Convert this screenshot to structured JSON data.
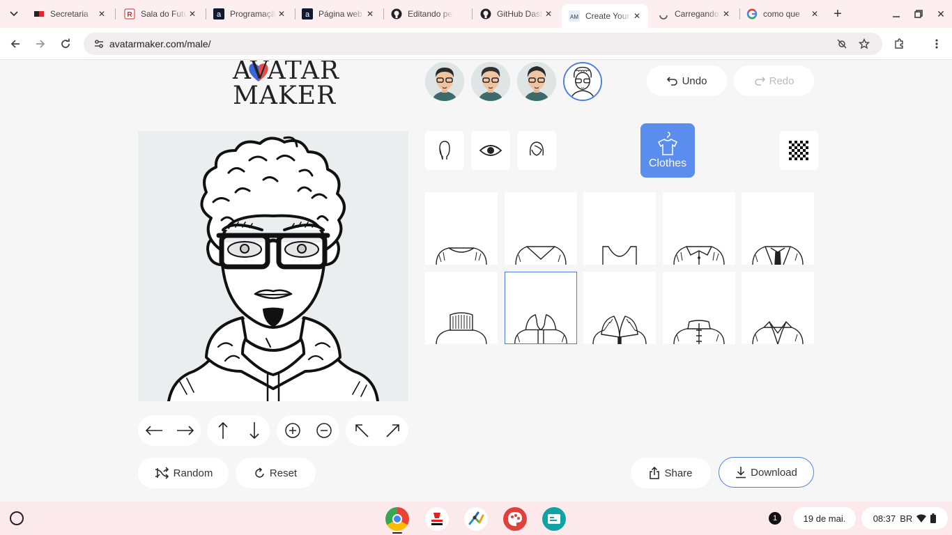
{
  "browser": {
    "tabs": [
      {
        "title": "Secretaria",
        "favicon": "red-flag-icon"
      },
      {
        "title": "Sala do Futuro",
        "favicon": "sala-futuro-icon"
      },
      {
        "title": "Programação",
        "favicon": "alura-icon"
      },
      {
        "title": "Página web",
        "favicon": "alura-icon"
      },
      {
        "title": "Editando perfil",
        "favicon": "github-icon"
      },
      {
        "title": "GitHub Dashboard",
        "favicon": "github-icon"
      },
      {
        "title": "Create Your Avatar",
        "favicon": "avatarmaker-icon",
        "active": true
      },
      {
        "title": "Carregando...",
        "favicon": "loading-icon"
      },
      {
        "title": "como que",
        "favicon": "google-icon"
      }
    ],
    "url": "avatarmaker.com/male/"
  },
  "app": {
    "logo_line1": "AVATAR",
    "logo_line2": "MAKER",
    "undo_label": "Undo",
    "redo_label": "Redo",
    "active_category": "Clothes",
    "random_label": "Random",
    "reset_label": "Reset",
    "share_label": "Share",
    "download_label": "Download",
    "accent_color": "#5b8def",
    "clothes_options": [
      "crew-neck-tshirt",
      "v-neck-tshirt",
      "scoop-neck-top",
      "collared-shirt",
      "suit-and-tie",
      "turtleneck",
      "hoodie",
      "fur-collar-coat",
      "mandarin-collar",
      "open-collar-jacket"
    ],
    "selected_clothes_index": 6
  },
  "shelf": {
    "notification_count": "1",
    "date": "19 de mai.",
    "time": "08:37",
    "locale": "BR"
  }
}
